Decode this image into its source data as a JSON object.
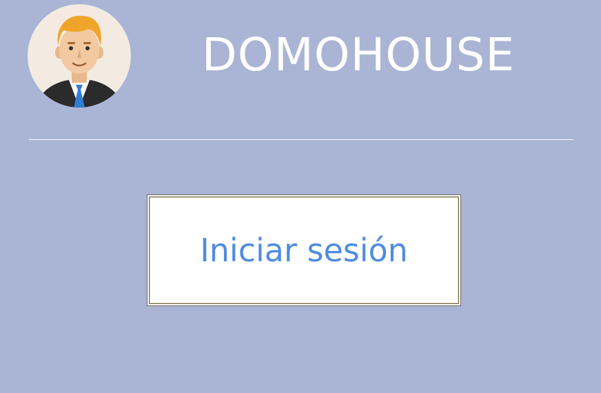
{
  "header": {
    "title": "DOMOHOUSE",
    "avatar_icon": "user-avatar-icon"
  },
  "actions": {
    "login_label": "Iniciar sesión"
  },
  "colors": {
    "background": "#aab5d5",
    "title": "#ffffff",
    "divider": "#ffffff",
    "button_bg": "#ffffff",
    "button_text": "#4f8ce0",
    "button_border": "#6e6450"
  }
}
